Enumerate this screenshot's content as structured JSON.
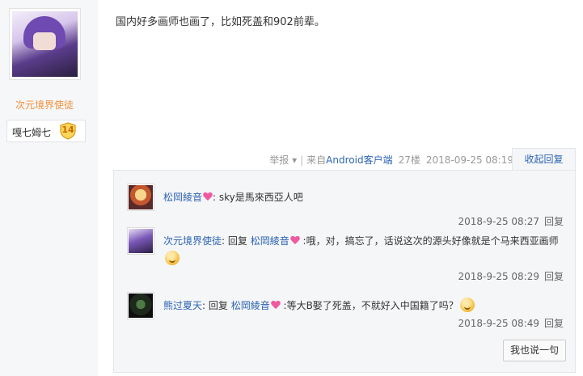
{
  "author": {
    "name": "次元境界使徒",
    "badge_name": "嘎七姆七",
    "badge_level": "14",
    "accent_color": "#f0903a"
  },
  "post": {
    "content": "国内好多画师也画了，比如死盖和902前辈。",
    "report_label": "举报 ▾",
    "source_prefix": "来自",
    "source_client": "Android客户端",
    "floor": "27楼",
    "time": "2018-09-25 08:19",
    "collapse_label": "收起回复"
  },
  "replies": [
    {
      "user": "松岡綾音",
      "separator": ": ",
      "text": "sky是馬來西亞人吧",
      "time": "2018-9-25 08:27",
      "reply_label": "回复"
    },
    {
      "user": "次元境界使徒",
      "separator": ": 回复 ",
      "target": "松岡綾音",
      "text": " :哦，对，搞忘了，话说这次的源头好像就是个马来西亚画师",
      "time": "2018-9-25 08:29",
      "reply_label": "回复"
    },
    {
      "user": "熊过夏天",
      "separator": ": 回复 ",
      "target": "松岡綾音",
      "text": " :等大B娶了死盖，不就好入中国籍了吗？",
      "time": "2018-9-25 08:49",
      "reply_label": "回复"
    }
  ],
  "say_button": "我也说一句",
  "icons": {
    "heart": "heart-icon",
    "emoji": "smile-emoji-icon",
    "shield": "level-shield-icon"
  },
  "colors": {
    "link": "#2d64b3",
    "heart": "#f05aa0",
    "reply_box_bg": "#f5f6f8"
  }
}
